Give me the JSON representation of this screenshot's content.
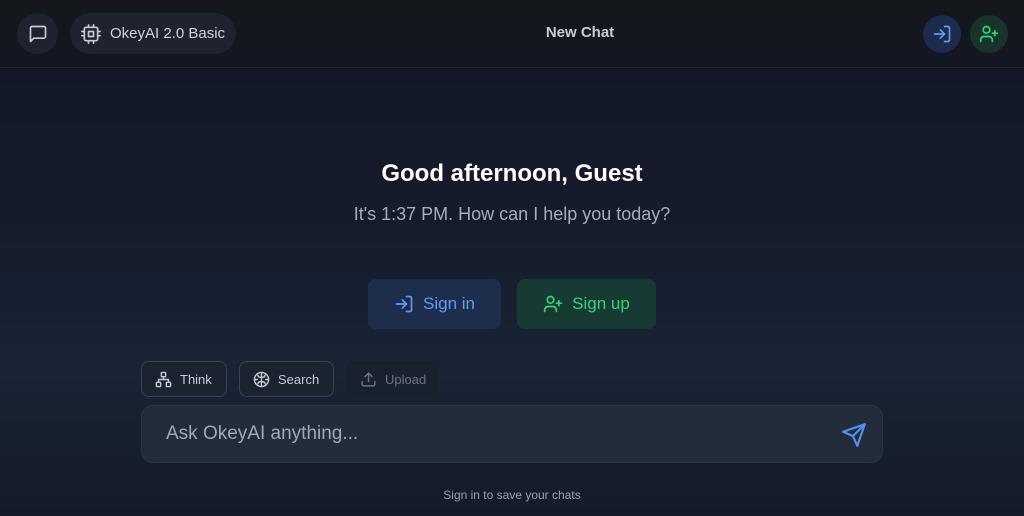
{
  "header": {
    "model_label": "OkeyAI 2.0 Basic",
    "title": "New Chat",
    "icons": {
      "chat": "message-square-icon",
      "model": "cpu-chip-icon",
      "sign_in": "log-in-icon",
      "sign_up": "user-plus-icon"
    }
  },
  "hero": {
    "greeting": "Good afternoon, Guest",
    "subtitle": "It's 1:37 PM. How can I help you today?"
  },
  "actions": {
    "sign_in_label": "Sign in",
    "sign_up_label": "Sign up"
  },
  "tools": {
    "think_label": "Think",
    "search_label": "Search",
    "upload_label": "Upload"
  },
  "composer": {
    "placeholder": "Ask OkeyAI anything...",
    "value": ""
  },
  "footer": {
    "note": "Sign in to save your chats"
  },
  "colors": {
    "accent_blue": "#5b9cf6",
    "accent_green": "#34d57a",
    "background": "#141b2b"
  }
}
